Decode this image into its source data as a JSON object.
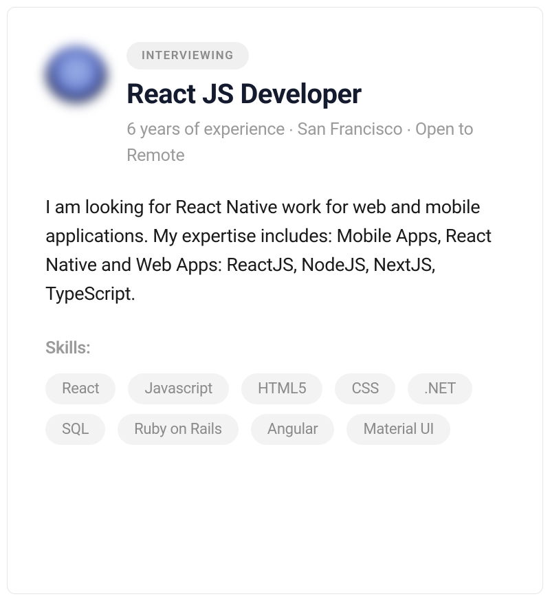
{
  "profile": {
    "status": "INTERVIEWING",
    "title": "React JS Developer",
    "meta": "6 years of experience ∙ San Francisco ∙ Open to Remote",
    "description": "I am looking for React Native work for web and mobile applications. My expertise includes: Mobile Apps, React Native and Web Apps: ReactJS, NodeJS, NextJS, TypeScript.",
    "skills_label": "Skills:",
    "skills": [
      "React",
      "Javascript",
      "HTML5",
      "CSS",
      ".NET",
      "SQL",
      "Ruby on Rails",
      "Angular",
      "Material UI"
    ]
  }
}
